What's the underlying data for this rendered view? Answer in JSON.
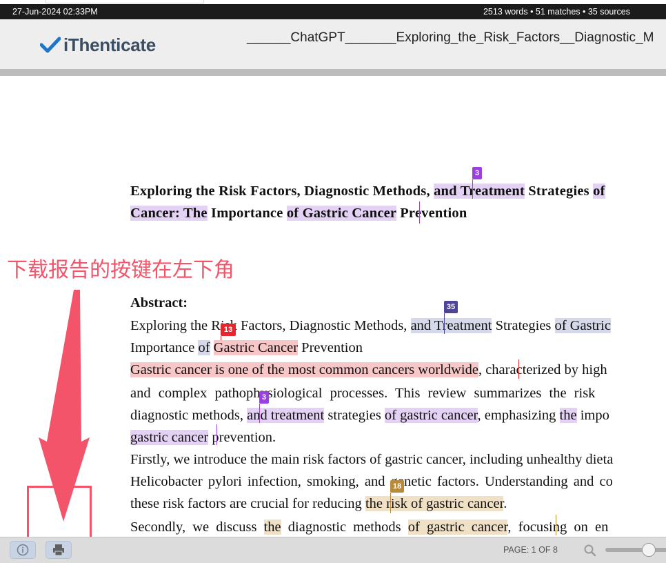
{
  "status": {
    "datetime": "27-Jun-2024 02:33PM",
    "stats": "2513 words • 51 matches • 35 sources"
  },
  "header": {
    "logo_text": "iThenticate",
    "doc_title": "______ChatGPT_______Exploring_the_Risk_Factors__Diagnostic_M"
  },
  "colors": {
    "purple": "#9a3fe0",
    "navy": "#4d4596",
    "red": "#e6262e",
    "gold": "#b88a3a",
    "annotation": "#f4546a"
  },
  "markers": {
    "m1": "3",
    "m2": "35",
    "m3": "13",
    "m4": "3",
    "m5": "18"
  },
  "document": {
    "title_l1": [
      "Exploring the Risk Factors, Diagnostic Methods, ",
      "and Treatment",
      " Strategies ",
      "of"
    ],
    "title_l2": [
      "Cancer: The",
      " Importance ",
      "of Gastric Cancer",
      " Prevention"
    ],
    "abstract_heading": "Abstract:",
    "b1": [
      "Exploring the ",
      "Risk Factors, Diagnostic Methods, ",
      "and Treatment",
      " Strategies ",
      "of Gastric"
    ],
    "b2": [
      "Importance ",
      "of",
      " ",
      "Gastric Cancer",
      " Prevention"
    ],
    "b3": [
      "Gastric cancer is one of the most common cancers worldwide",
      ", characterized by high"
    ],
    "b4": "and complex pathophysiological processes. This review summarizes the risk",
    "b5": [
      "diagnostic methods, ",
      "and treatment",
      " strategies ",
      "of gastric cancer",
      ", emphasizing ",
      "the",
      " impo"
    ],
    "b6": [
      "gastric cancer",
      " prevention."
    ],
    "b7": "Firstly, we introduce the main risk factors of gastric cancer, including unhealthy dieta",
    "b8": "Helicobacter pylori infection, smoking, and genetic factors. Understanding and co",
    "b9": [
      "these risk factors are crucial for reducing ",
      "the risk of gastric cancer",
      "."
    ],
    "b10": [
      "Secondly, we discuss ",
      "the",
      " diagnostic methods ",
      "of gastric cancer",
      ", focusing on en"
    ]
  },
  "annotation": {
    "text": "下载报告的按键在左下角"
  },
  "footer": {
    "info_icon": "info-icon",
    "print_icon": "print-icon",
    "page_indicator": "PAGE: 1 OF 8",
    "zoom_icon": "zoom-icon",
    "zoom_level": 0.6
  }
}
